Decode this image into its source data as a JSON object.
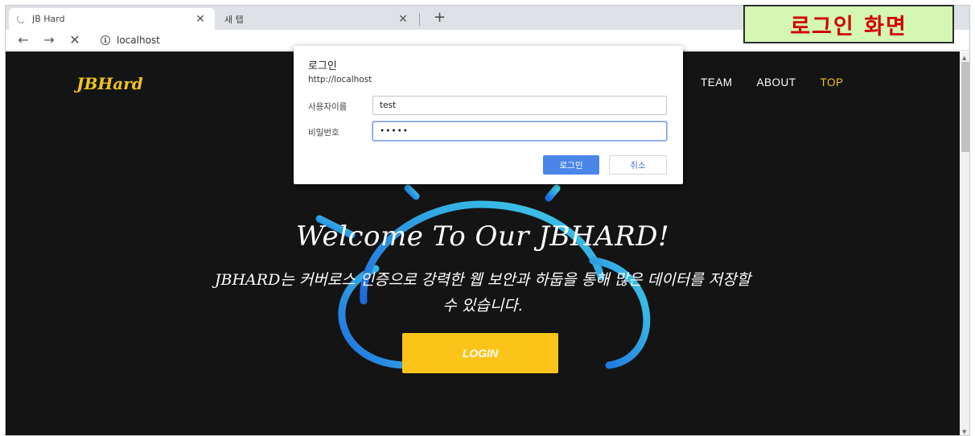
{
  "browser": {
    "tabs": [
      {
        "title": "JB Hard",
        "close": "✕"
      },
      {
        "title": "새 탭",
        "close": "✕"
      }
    ],
    "new_tab": "+",
    "nav": {
      "back": "←",
      "forward": "→",
      "stop": "✕"
    },
    "address": "localhost",
    "info_glyph": "i"
  },
  "site": {
    "logo": "JBHard",
    "nav_items": [
      "TEAM",
      "ABOUT",
      "TOP"
    ],
    "active_nav": "TOP",
    "headline": "Welcome To Our JBHARD!",
    "subtext_line1": "JBHARD는 커버로스 인증으로 강력한 웹 보안과 하둡을 통해 많은 데이터를 저장할",
    "subtext_line2": "수 있습니다.",
    "login_button": "LOGIN",
    "accent_color": "#fcc419"
  },
  "dialog": {
    "title": "로그인",
    "url": "http://localhost",
    "username_label": "사용자이름",
    "username_value": "test",
    "password_label": "비밀번호",
    "password_value": "•••••",
    "ok_label": "로그인",
    "cancel_label": "취소",
    "ok_color": "#4a86e8"
  },
  "caption": {
    "text": "로그인 화면",
    "text_color": "#d10000",
    "background": "#d4f7b4"
  }
}
